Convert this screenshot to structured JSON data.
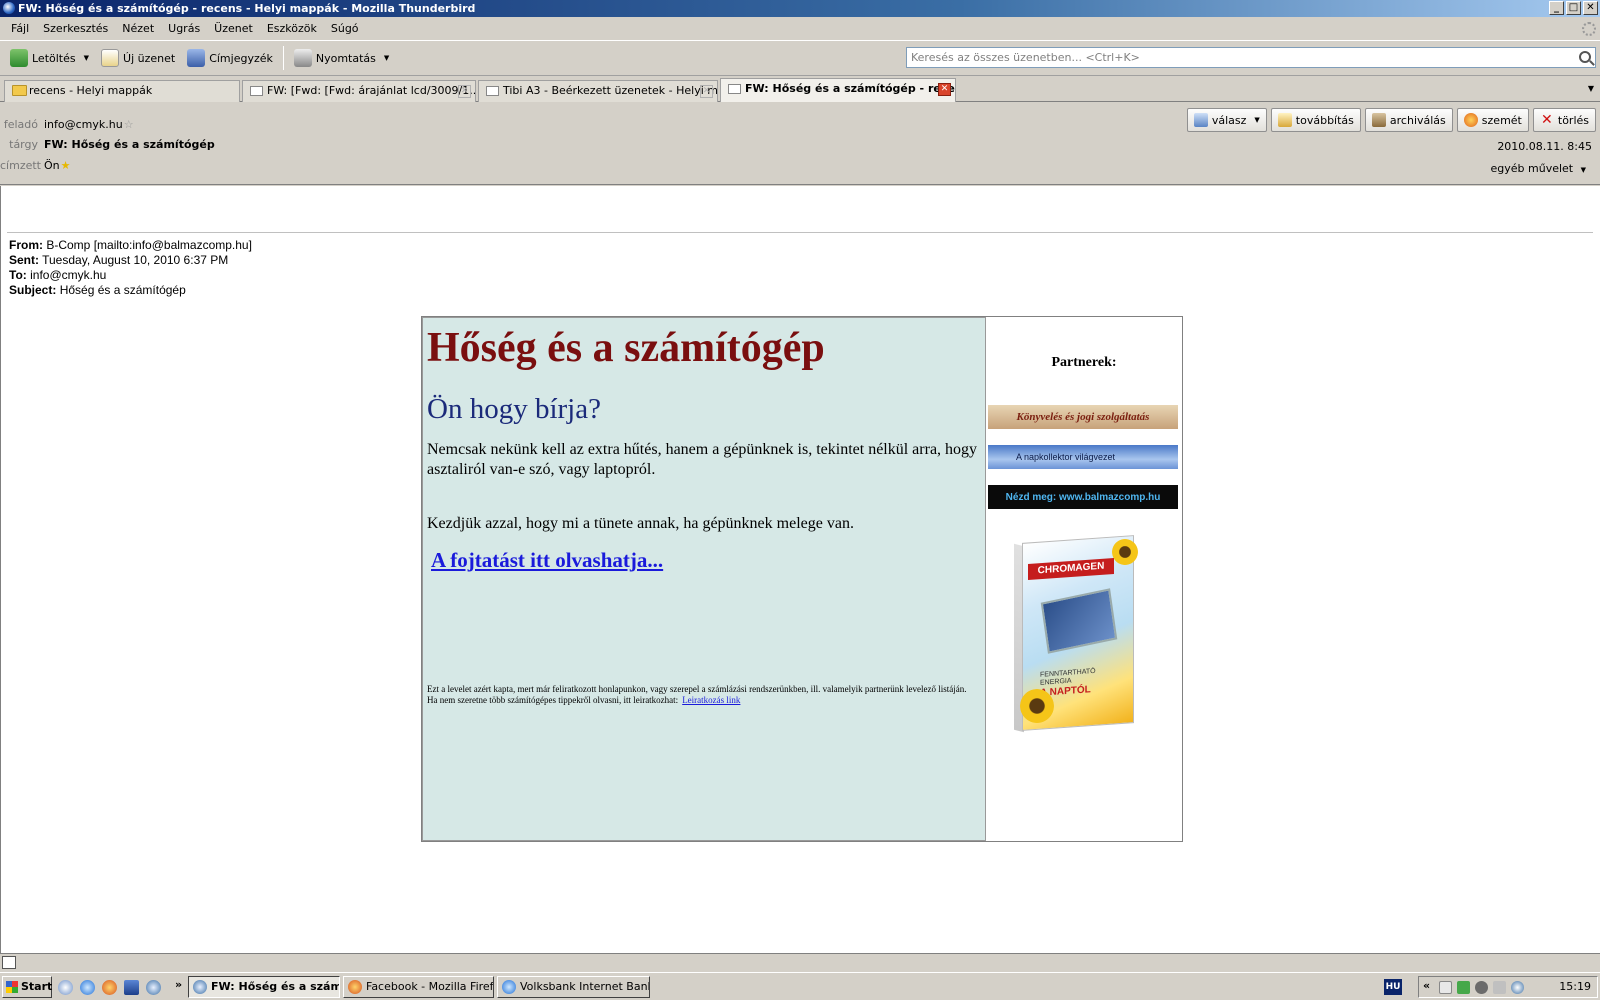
{
  "window": {
    "title": "FW: Hőség és a számítógép - recens - Helyi mappák - Mozilla Thunderbird",
    "minimize": "_",
    "maximize": "□",
    "close": "✕"
  },
  "menu": [
    "Fájl",
    "Szerkesztés",
    "Nézet",
    "Ugrás",
    "Üzenet",
    "Eszközök",
    "Súgó"
  ],
  "toolbar": {
    "get_mail": "Letöltés",
    "new_message": "Új üzenet",
    "address_book": "Címjegyzék",
    "print": "Nyomtatás",
    "search_placeholder": "Keresés az összes üzenetben... <Ctrl+K>"
  },
  "tabs": [
    {
      "label": "recens - Helyi mappák"
    },
    {
      "label": "FW: [Fwd: [Fwd: árajánlat lcd/3009/1..."
    },
    {
      "label": "Tibi A3 - Beérkezett üzenetek - Helyi m..."
    },
    {
      "label": "FW: Hőség és a számítógép - rece..."
    }
  ],
  "header": {
    "from_label": "feladó",
    "from_value": "info@cmyk.hu",
    "subject_label": "tárgy",
    "subject_value": "FW: Hőség és a számítógép",
    "to_label": "címzett",
    "to_value": "Ön",
    "date": "2010.08.11. 8:45",
    "other_actions": "egyéb művelet",
    "actions": {
      "reply": "válasz",
      "forward": "továbbítás",
      "archive": "archiválás",
      "junk": "szemét",
      "delete": "törlés"
    }
  },
  "forwarded": {
    "from_label": "From:",
    "from_value": "B-Comp [mailto:info@balmazcomp.hu]",
    "sent_label": "Sent:",
    "sent_value": "Tuesday, August 10, 2010 6:37 PM",
    "to_label": "To:",
    "to_value": "info@cmyk.hu",
    "subject_label": "Subject:",
    "subject_value": "Hőség és a számítógép"
  },
  "newsletter": {
    "title": "Hőség és a számítógép",
    "subtitle": "Ön hogy bírja?",
    "para1": "Nemcsak nekünk kell az extra hűtés, hanem a gépünknek is, tekintet nélkül arra, hogy asztaliról van-e szó, vagy laptopról.",
    "para2": "Kezdjük azzal, hogy mi a tünete annak, ha gépünknek melege van.",
    "link": "A fojtatást itt olvashatja...",
    "footer": "Ezt a levelet azért kapta, mert már feliratkozott honlapunkon, vagy szerepel a számlázási rendszerünkben, ill. valamelyik partnerünk levelező listáján. Ha nem szeretne több számítógépes tippekről olvasni, itt leiratkozhat:",
    "unsubscribe": "Leiratkozás link",
    "partners": "Partnerek:",
    "banner1": "Könyvelés és jogi szolgáltatás",
    "banner2": "A napkollektor világvezet",
    "banner3": "Nézd meg: www.balmazcomp.hu",
    "product_brand": "CHROMAGEN",
    "product_text": "FENNTARTHATÓ ENERGIA",
    "product_tagline": "A NAPTÓL"
  },
  "taskbar": {
    "start": "Start",
    "items": [
      "FW: Hőség és a számí...",
      "Facebook - Mozilla Firefox",
      "Volksbank Internet Banki..."
    ],
    "language": "HU",
    "clock": "15:19",
    "tray_chevron": "«",
    "quicklaunch_chevron": "»"
  }
}
